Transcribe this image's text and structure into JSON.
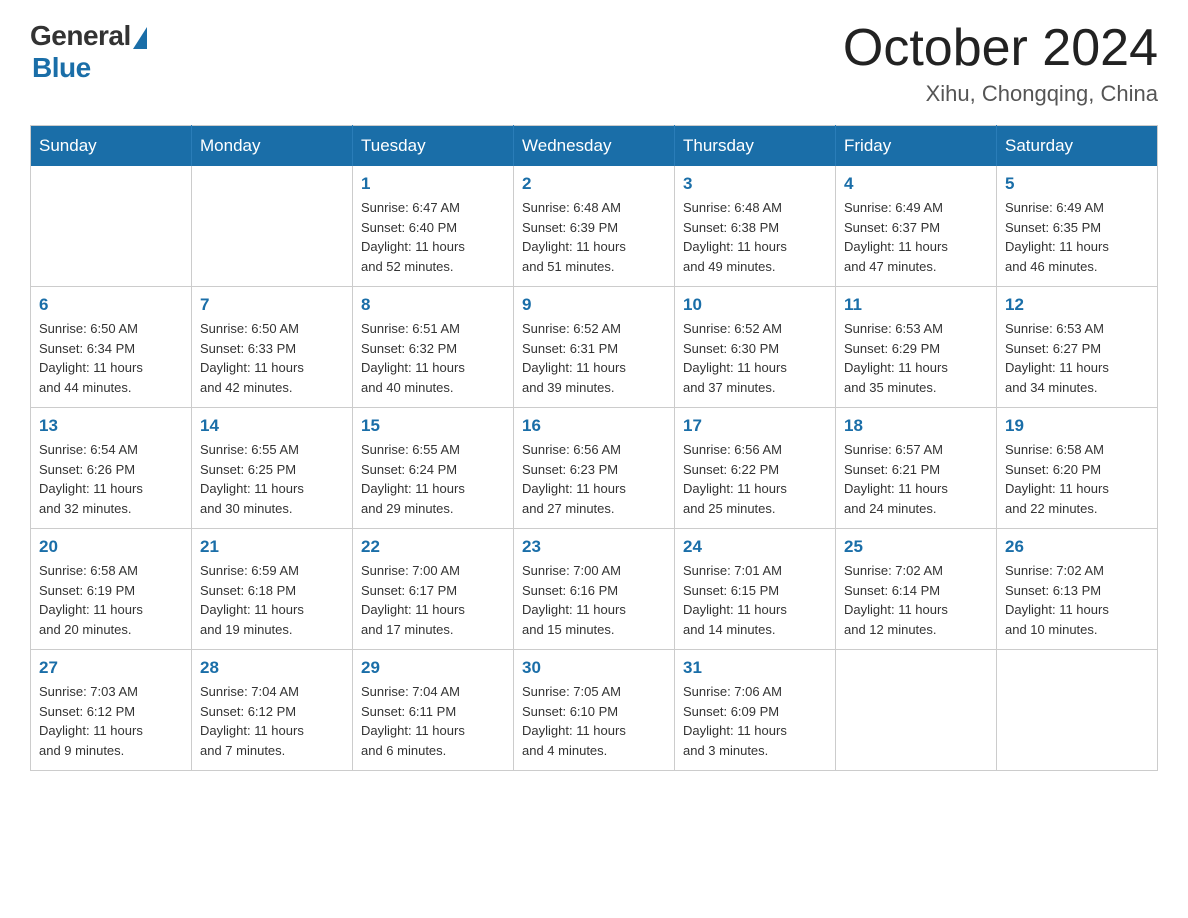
{
  "header": {
    "logo": {
      "general": "General",
      "blue": "Blue"
    },
    "title": "October 2024",
    "location": "Xihu, Chongqing, China"
  },
  "weekdays": [
    "Sunday",
    "Monday",
    "Tuesday",
    "Wednesday",
    "Thursday",
    "Friday",
    "Saturday"
  ],
  "weeks": [
    [
      null,
      null,
      {
        "day": "1",
        "sunrise": "6:47 AM",
        "sunset": "6:40 PM",
        "daylight": "11 hours and 52 minutes."
      },
      {
        "day": "2",
        "sunrise": "6:48 AM",
        "sunset": "6:39 PM",
        "daylight": "11 hours and 51 minutes."
      },
      {
        "day": "3",
        "sunrise": "6:48 AM",
        "sunset": "6:38 PM",
        "daylight": "11 hours and 49 minutes."
      },
      {
        "day": "4",
        "sunrise": "6:49 AM",
        "sunset": "6:37 PM",
        "daylight": "11 hours and 47 minutes."
      },
      {
        "day": "5",
        "sunrise": "6:49 AM",
        "sunset": "6:35 PM",
        "daylight": "11 hours and 46 minutes."
      }
    ],
    [
      {
        "day": "6",
        "sunrise": "6:50 AM",
        "sunset": "6:34 PM",
        "daylight": "11 hours and 44 minutes."
      },
      {
        "day": "7",
        "sunrise": "6:50 AM",
        "sunset": "6:33 PM",
        "daylight": "11 hours and 42 minutes."
      },
      {
        "day": "8",
        "sunrise": "6:51 AM",
        "sunset": "6:32 PM",
        "daylight": "11 hours and 40 minutes."
      },
      {
        "day": "9",
        "sunrise": "6:52 AM",
        "sunset": "6:31 PM",
        "daylight": "11 hours and 39 minutes."
      },
      {
        "day": "10",
        "sunrise": "6:52 AM",
        "sunset": "6:30 PM",
        "daylight": "11 hours and 37 minutes."
      },
      {
        "day": "11",
        "sunrise": "6:53 AM",
        "sunset": "6:29 PM",
        "daylight": "11 hours and 35 minutes."
      },
      {
        "day": "12",
        "sunrise": "6:53 AM",
        "sunset": "6:27 PM",
        "daylight": "11 hours and 34 minutes."
      }
    ],
    [
      {
        "day": "13",
        "sunrise": "6:54 AM",
        "sunset": "6:26 PM",
        "daylight": "11 hours and 32 minutes."
      },
      {
        "day": "14",
        "sunrise": "6:55 AM",
        "sunset": "6:25 PM",
        "daylight": "11 hours and 30 minutes."
      },
      {
        "day": "15",
        "sunrise": "6:55 AM",
        "sunset": "6:24 PM",
        "daylight": "11 hours and 29 minutes."
      },
      {
        "day": "16",
        "sunrise": "6:56 AM",
        "sunset": "6:23 PM",
        "daylight": "11 hours and 27 minutes."
      },
      {
        "day": "17",
        "sunrise": "6:56 AM",
        "sunset": "6:22 PM",
        "daylight": "11 hours and 25 minutes."
      },
      {
        "day": "18",
        "sunrise": "6:57 AM",
        "sunset": "6:21 PM",
        "daylight": "11 hours and 24 minutes."
      },
      {
        "day": "19",
        "sunrise": "6:58 AM",
        "sunset": "6:20 PM",
        "daylight": "11 hours and 22 minutes."
      }
    ],
    [
      {
        "day": "20",
        "sunrise": "6:58 AM",
        "sunset": "6:19 PM",
        "daylight": "11 hours and 20 minutes."
      },
      {
        "day": "21",
        "sunrise": "6:59 AM",
        "sunset": "6:18 PM",
        "daylight": "11 hours and 19 minutes."
      },
      {
        "day": "22",
        "sunrise": "7:00 AM",
        "sunset": "6:17 PM",
        "daylight": "11 hours and 17 minutes."
      },
      {
        "day": "23",
        "sunrise": "7:00 AM",
        "sunset": "6:16 PM",
        "daylight": "11 hours and 15 minutes."
      },
      {
        "day": "24",
        "sunrise": "7:01 AM",
        "sunset": "6:15 PM",
        "daylight": "11 hours and 14 minutes."
      },
      {
        "day": "25",
        "sunrise": "7:02 AM",
        "sunset": "6:14 PM",
        "daylight": "11 hours and 12 minutes."
      },
      {
        "day": "26",
        "sunrise": "7:02 AM",
        "sunset": "6:13 PM",
        "daylight": "11 hours and 10 minutes."
      }
    ],
    [
      {
        "day": "27",
        "sunrise": "7:03 AM",
        "sunset": "6:12 PM",
        "daylight": "11 hours and 9 minutes."
      },
      {
        "day": "28",
        "sunrise": "7:04 AM",
        "sunset": "6:12 PM",
        "daylight": "11 hours and 7 minutes."
      },
      {
        "day": "29",
        "sunrise": "7:04 AM",
        "sunset": "6:11 PM",
        "daylight": "11 hours and 6 minutes."
      },
      {
        "day": "30",
        "sunrise": "7:05 AM",
        "sunset": "6:10 PM",
        "daylight": "11 hours and 4 minutes."
      },
      {
        "day": "31",
        "sunrise": "7:06 AM",
        "sunset": "6:09 PM",
        "daylight": "11 hours and 3 minutes."
      },
      null,
      null
    ]
  ],
  "labels": {
    "sunrise": "Sunrise:",
    "sunset": "Sunset:",
    "daylight": "Daylight:"
  }
}
